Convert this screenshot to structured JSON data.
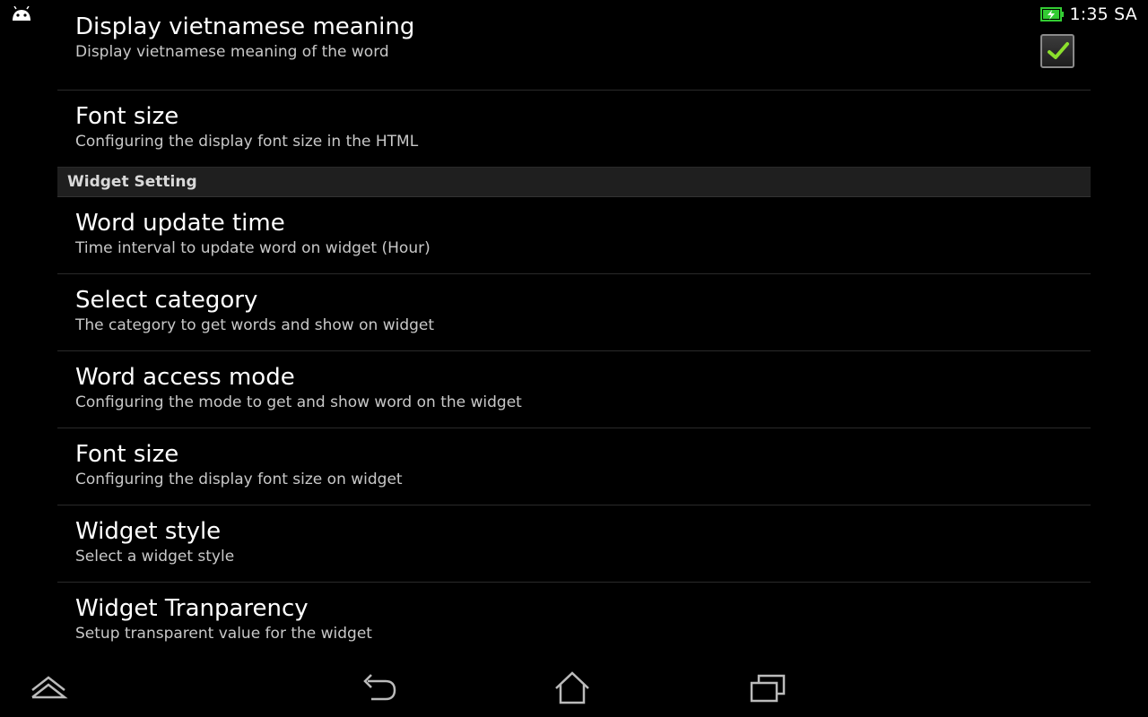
{
  "status_bar": {
    "time": "1:35 SA",
    "notification_icon": "android-icon",
    "battery_icon": "battery-charging-icon",
    "battery_color": "#33cc33"
  },
  "preferences": {
    "display_meaning": {
      "title": "Display vietnamese meaning",
      "summary": "Display vietnamese meaning of the word",
      "checked": true
    },
    "font_size_html": {
      "title": "Font size",
      "summary": "Configuring the display font size in the HTML"
    },
    "widget_category": {
      "label": "Widget Setting"
    },
    "word_update_time": {
      "title": "Word update time",
      "summary": "Time interval to update word on widget (Hour)"
    },
    "select_category": {
      "title": "Select category",
      "summary": "The category to get words and show on widget"
    },
    "word_access_mode": {
      "title": "Word access mode",
      "summary": "Configuring the mode to get and show word on the widget"
    },
    "font_size_widget": {
      "title": "Font size",
      "summary": "Configuring the display font size on widget"
    },
    "widget_style": {
      "title": "Widget style",
      "summary": "Select a widget style"
    },
    "widget_transparency": {
      "title": "Widget Tranparency",
      "summary": "Setup transparent value for the widget"
    }
  },
  "nav_bar": {
    "icons": [
      "hide-keyboard-icon",
      "back-icon",
      "home-icon",
      "recent-apps-icon"
    ]
  },
  "colors": {
    "background": "#000000",
    "check_mark": "#8be02c",
    "category_bg": "#1f1f1f"
  }
}
